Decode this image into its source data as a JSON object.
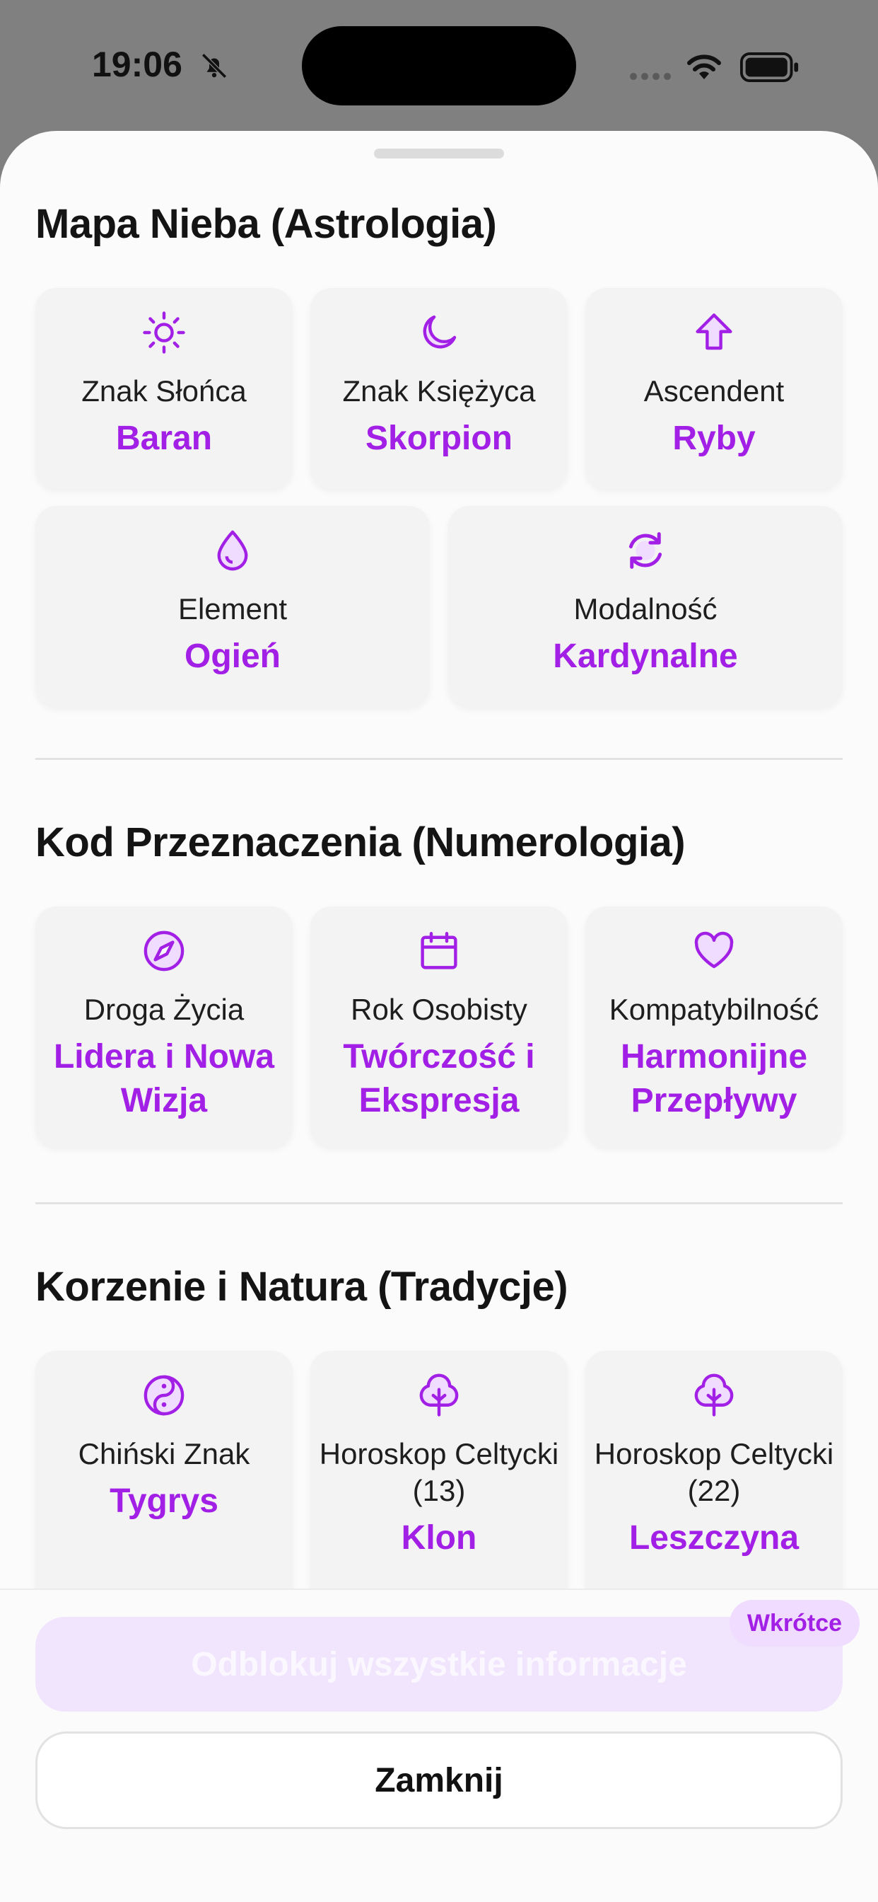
{
  "status_bar": {
    "time": "19:06"
  },
  "sections": [
    {
      "title": "Mapa Nieba (Astrologia)",
      "cards": [
        {
          "icon": "sun-icon",
          "label": "Znak Słońca",
          "value": "Baran"
        },
        {
          "icon": "moon-icon",
          "label": "Znak Księżyca",
          "value": "Skorpion"
        },
        {
          "icon": "arrow-up-icon",
          "label": "Ascendent",
          "value": "Ryby"
        },
        {
          "icon": "droplet-icon",
          "label": "Element",
          "value": "Ogień"
        },
        {
          "icon": "refresh-icon",
          "label": "Modalność",
          "value": "Kardynalne"
        }
      ]
    },
    {
      "title": "Kod Przeznaczenia (Numerologia)",
      "cards": [
        {
          "icon": "compass-icon",
          "label": "Droga Życia",
          "value": "Lidera i Nowa Wizja"
        },
        {
          "icon": "calendar-icon",
          "label": "Rok Osobisty",
          "value": "Twórczość i Ekspresja"
        },
        {
          "icon": "heart-icon",
          "label": "Kompatybilność",
          "value": "Harmonijne Przepływy"
        }
      ]
    },
    {
      "title": "Korzenie i Natura (Tradycje)",
      "cards": [
        {
          "icon": "yin-yang-icon",
          "label": "Chiński Znak",
          "value": "Tygrys"
        },
        {
          "icon": "tree-icon",
          "label": "Horoskop Celtycki (13)",
          "value": "Klon"
        },
        {
          "icon": "tree-icon",
          "label": "Horoskop Celtycki (22)",
          "value": "Leszczyna"
        }
      ]
    }
  ],
  "actions": {
    "unlock_label": "Odblokuj wszystkie informacje",
    "soon_badge": "Wkrótce",
    "close_label": "Zamknij"
  },
  "colors": {
    "accent": "#a21fe6",
    "card_bg": "#f3f3f4",
    "sheet_bg": "#fbfbfb"
  }
}
